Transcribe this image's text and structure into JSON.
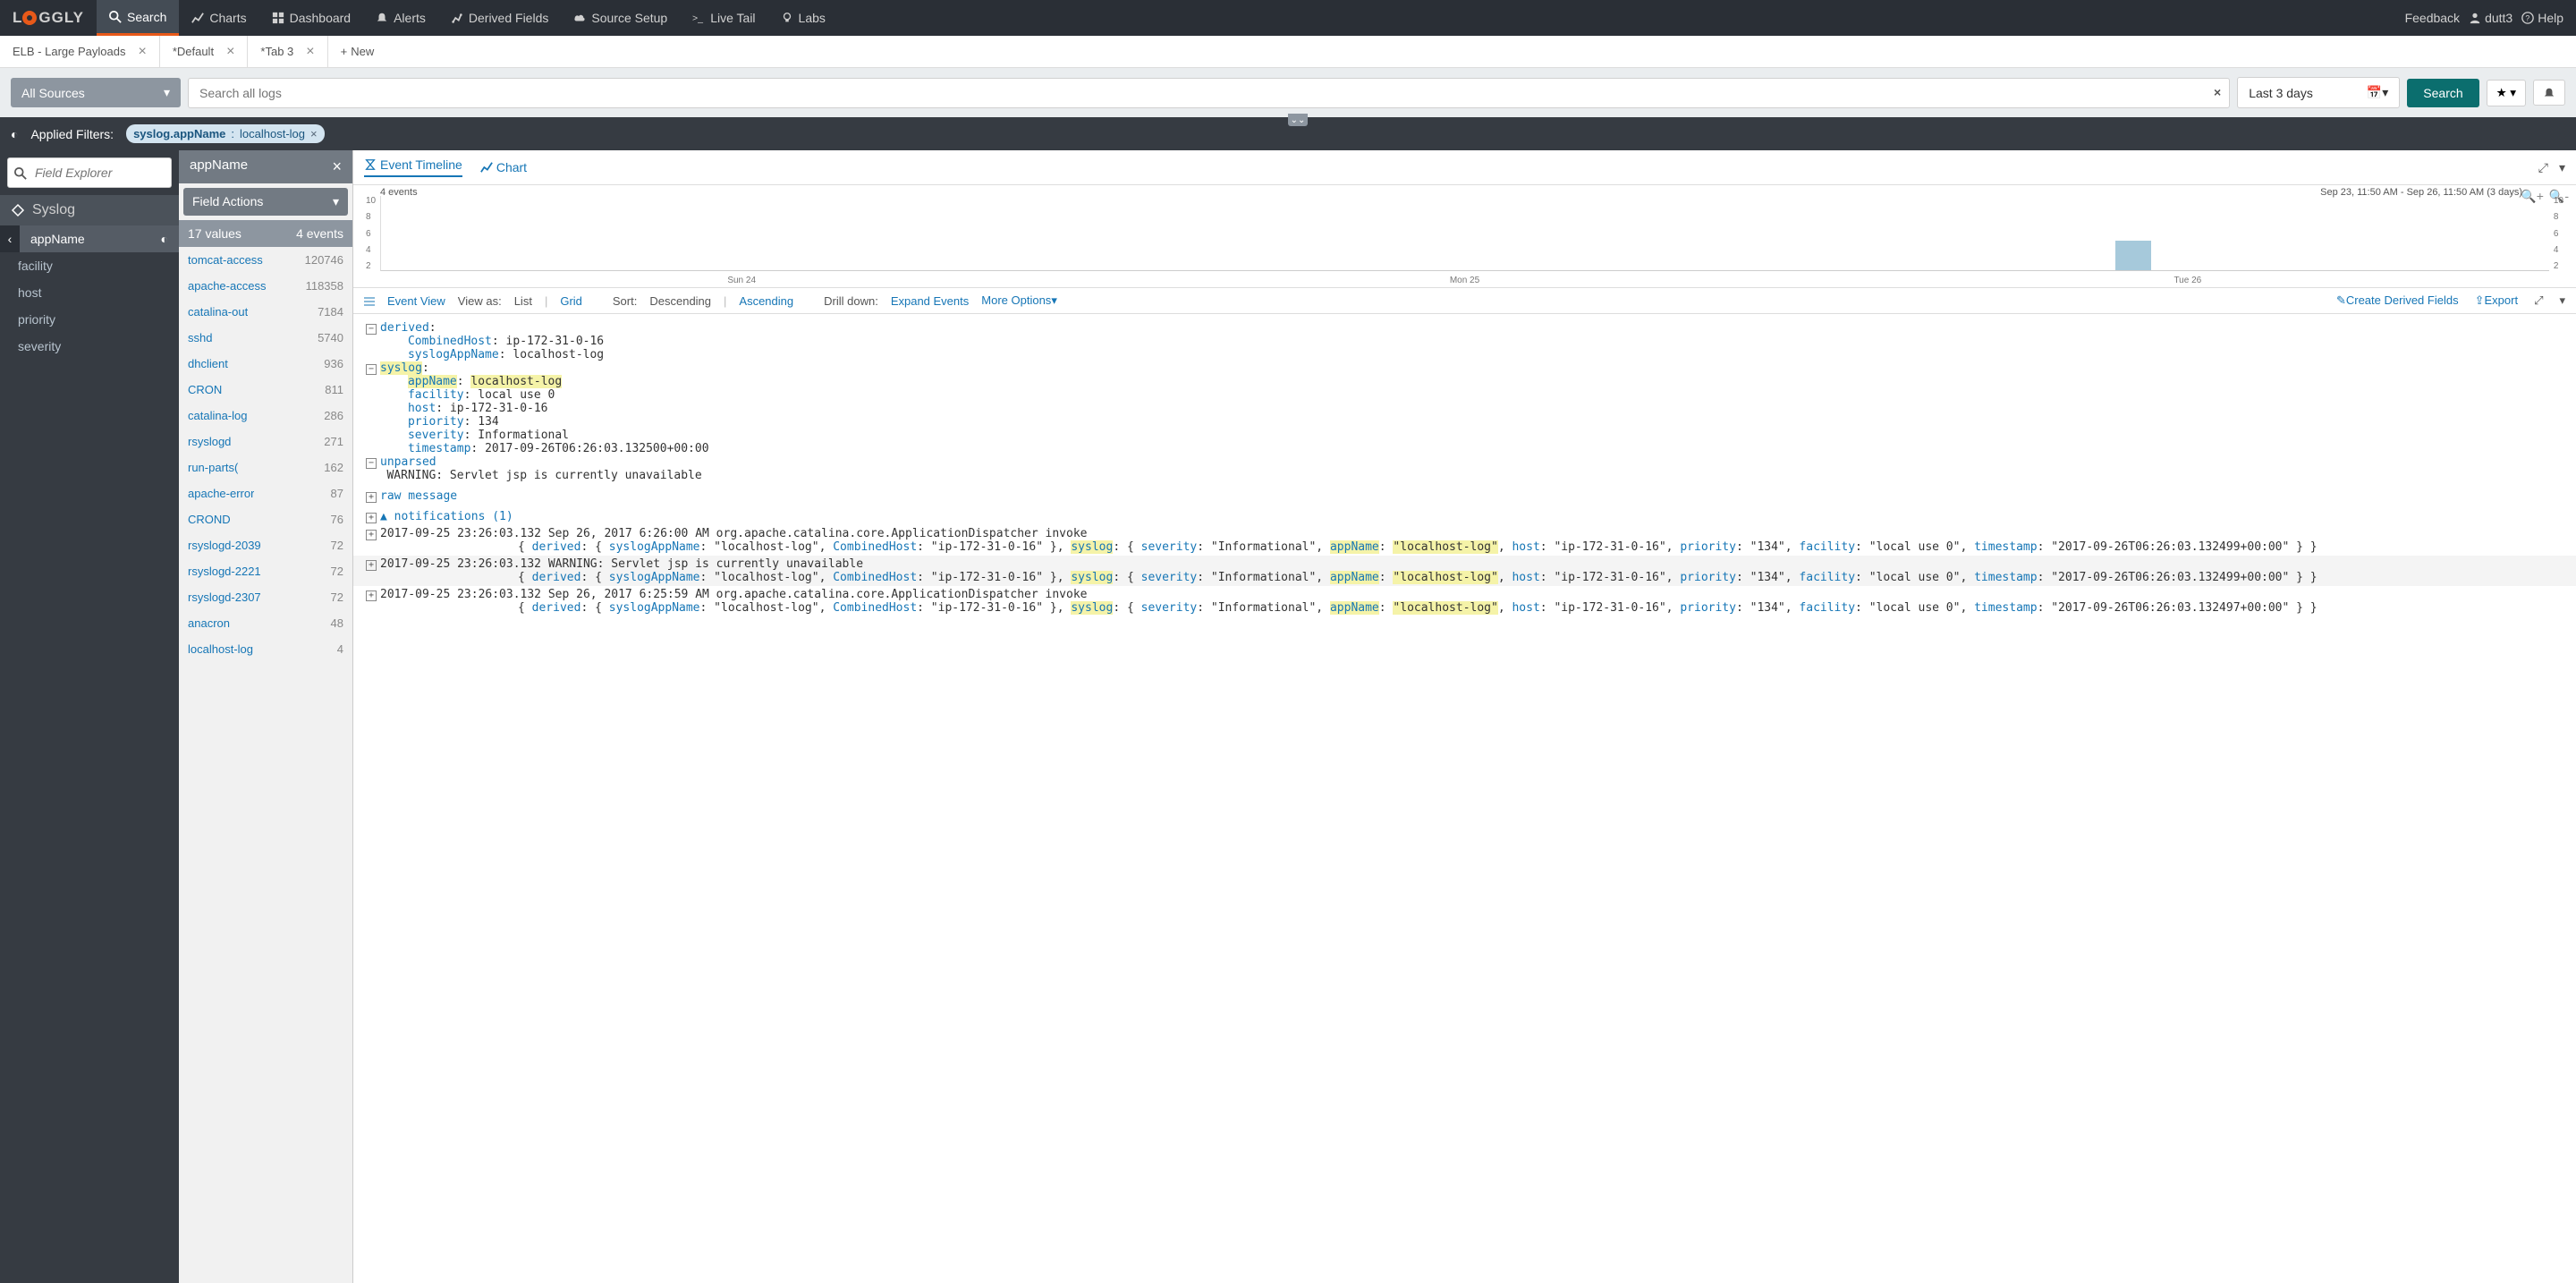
{
  "brand": "LOGGLY",
  "nav": {
    "items": [
      "Search",
      "Charts",
      "Dashboard",
      "Alerts",
      "Derived Fields",
      "Source Setup",
      "Live Tail",
      "Labs"
    ],
    "active": 0,
    "feedback": "Feedback",
    "user": "dutt3",
    "help": "Help"
  },
  "tabs": [
    {
      "label": "ELB - Large Payloads",
      "closeable": true
    },
    {
      "label": "*Default",
      "closeable": true
    },
    {
      "label": "*Tab 3",
      "closeable": true
    }
  ],
  "new_tab": "New",
  "search": {
    "sources": "All Sources",
    "placeholder": "Search all logs",
    "time": "Last 3 days",
    "button": "Search"
  },
  "filters": {
    "label": "Applied Filters:",
    "items": [
      {
        "key": "syslog.appName",
        "val": "localhost-log"
      }
    ]
  },
  "field_explorer_placeholder": "Field Explorer",
  "syslog": {
    "header": "Syslog",
    "items": [
      "appName",
      "facility",
      "host",
      "priority",
      "severity"
    ],
    "selected": 0
  },
  "appname_panel": {
    "title": "appName",
    "field_actions": "Field Actions",
    "values_label": "17 values",
    "events_label": "4 events",
    "values": [
      {
        "name": "tomcat-access",
        "count": "120746"
      },
      {
        "name": "apache-access",
        "count": "118358"
      },
      {
        "name": "catalina-out",
        "count": "7184"
      },
      {
        "name": "sshd",
        "count": "5740"
      },
      {
        "name": "dhclient",
        "count": "936"
      },
      {
        "name": "CRON",
        "count": "811"
      },
      {
        "name": "catalina-log",
        "count": "286"
      },
      {
        "name": "rsyslogd",
        "count": "271"
      },
      {
        "name": "run-parts(",
        "count": "162"
      },
      {
        "name": "apache-error",
        "count": "87"
      },
      {
        "name": "CROND",
        "count": "76"
      },
      {
        "name": "rsyslogd-2039",
        "count": "72"
      },
      {
        "name": "rsyslogd-2221",
        "count": "72"
      },
      {
        "name": "rsyslogd-2307",
        "count": "72"
      },
      {
        "name": "anacron",
        "count": "48"
      },
      {
        "name": "localhost-log",
        "count": "4"
      }
    ]
  },
  "timeline": {
    "tabs": [
      "Event Timeline",
      "Chart"
    ],
    "count": "4 events",
    "range": "Sep 23, 11:50 AM - Sep 26, 11:50 AM (3 days)",
    "yticks": [
      "10",
      "8",
      "6",
      "4",
      "2"
    ],
    "xticks": [
      "Sun 24",
      "Mon 25",
      "Tue 26"
    ]
  },
  "event_toolbar": {
    "event_view": "Event View",
    "view_as": "View as:",
    "list": "List",
    "grid": "Grid",
    "sort": "Sort:",
    "desc": "Descending",
    "asc": "Ascending",
    "drill": "Drill down:",
    "expand": "Expand Events",
    "more": "More Options",
    "derived": "Create Derived Fields",
    "export": "Export"
  },
  "expanded": {
    "derived_label": "derived",
    "CombinedHost": "ip-172-31-0-16",
    "syslogAppName": "localhost-log",
    "syslog_label": "syslog",
    "appName": "localhost-log",
    "facility": "local use 0",
    "host": "ip-172-31-0-16",
    "priority": "134",
    "severity": "Informational",
    "timestamp": "2017-09-26T06:26:03.132500+00:00",
    "unparsed_label": "unparsed",
    "unparsed": "WARNING: Servlet jsp is currently unavailable",
    "raw": "raw message",
    "notifications": "notifications (1)"
  },
  "events": [
    {
      "ts": "2017-09-25 23:26:03.132",
      "msg": "Sep 26, 2017 6:26:00 AM org.apache.catalina.core.ApplicationDispatcher invoke",
      "timestamp": "2017-09-26T06:26:03.132499+00:00"
    },
    {
      "ts": "2017-09-25 23:26:03.132",
      "msg": "WARNING: Servlet jsp is currently unavailable",
      "timestamp": "2017-09-26T06:26:03.132499+00:00"
    },
    {
      "ts": "2017-09-25 23:26:03.132",
      "msg": "Sep 26, 2017 6:25:59 AM org.apache.catalina.core.ApplicationDispatcher invoke",
      "timestamp": "2017-09-26T06:26:03.132497+00:00"
    }
  ],
  "ev_json": {
    "derived": "derived",
    "syslogAppName": "syslogAppName",
    "syslogAppName_v": "localhost-log",
    "CombinedHost": "CombinedHost",
    "CombinedHost_v": "ip-172-31-0-16",
    "syslog": "syslog",
    "severity": "severity",
    "severity_v": "Informational",
    "appName": "appName",
    "appName_v": "localhost-log",
    "host": "host",
    "host_v": "ip-172-31-0-16",
    "priority": "priority",
    "priority_v": "134",
    "facility": "facility",
    "facility_v": "local use 0",
    "timestamp": "timestamp"
  },
  "chart_data": {
    "type": "bar",
    "title": "4 events",
    "range": "Sep 23, 11:50 AM - Sep 26, 11:50 AM (3 days)",
    "ylim": [
      0,
      10
    ],
    "yticks": [
      2,
      4,
      6,
      8,
      10
    ],
    "categories": [
      "Sun 24",
      "Mon 25",
      "Tue 26"
    ],
    "values": [
      0,
      0,
      4
    ]
  }
}
